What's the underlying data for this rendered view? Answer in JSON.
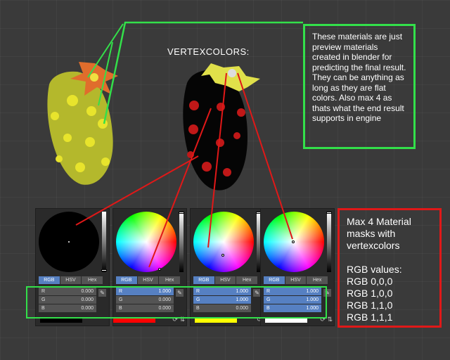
{
  "header": {
    "vertexcolors_label": "VERTEXCOLORS:"
  },
  "notes": {
    "green": "These materials are just preview materials created in blender for predicting the final result. They can be anything as long as they are flat colors. Also max 4 as thats what the end result supports in engine",
    "red_lines": [
      "Max 4 Material",
      "masks with",
      "vertexcolors",
      "",
      "RGB values:",
      "RGB 0,0,0",
      "RGB 1,0,0",
      "RGB 1,1,0",
      "RGB 1,1,1"
    ]
  },
  "pickers": [
    {
      "name": "black",
      "tabs": [
        "RGB",
        "HSV",
        "Hex"
      ],
      "fields": [
        {
          "label": "R",
          "value": "0.000"
        },
        {
          "label": "G",
          "value": "0.000"
        },
        {
          "label": "B",
          "value": "0.000"
        }
      ],
      "swatch_color": "#000000"
    },
    {
      "name": "red",
      "tabs": [
        "RGB",
        "HSV",
        "Hex"
      ],
      "fields": [
        {
          "label": "R",
          "value": "1.000"
        },
        {
          "label": "G",
          "value": "0.000"
        },
        {
          "label": "B",
          "value": "0.000"
        }
      ],
      "swatch_color": "#ff0000"
    },
    {
      "name": "yellow",
      "tabs": [
        "RGB",
        "HSV",
        "Hex"
      ],
      "fields": [
        {
          "label": "R",
          "value": "1.000"
        },
        {
          "label": "G",
          "value": "1.000"
        },
        {
          "label": "B",
          "value": "0.000"
        }
      ],
      "swatch_color": "#ffff00"
    },
    {
      "name": "white",
      "tabs": [
        "RGB",
        "HSV",
        "Hex"
      ],
      "fields": [
        {
          "label": "R",
          "value": "1.000"
        },
        {
          "label": "G",
          "value": "1.000"
        },
        {
          "label": "B",
          "value": "1.000"
        }
      ],
      "swatch_color": "#ffffff"
    }
  ],
  "colors": {
    "green_outline": "#33e04a",
    "red_outline": "#e01818",
    "active_tab": "#5680c2"
  }
}
